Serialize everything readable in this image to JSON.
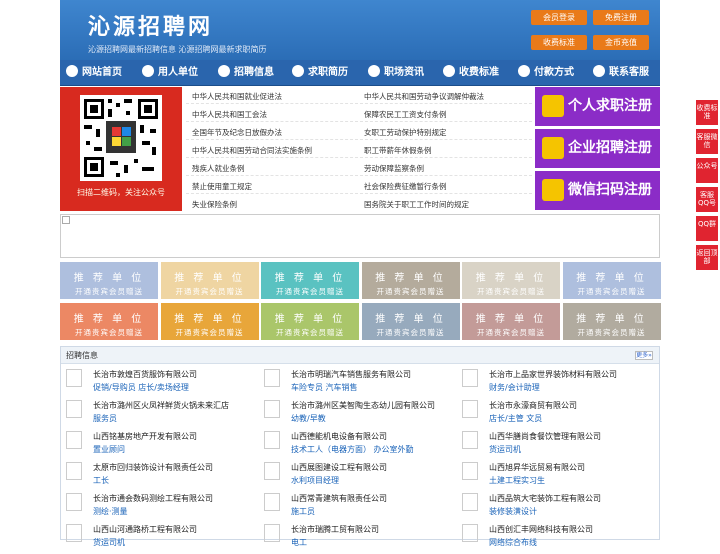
{
  "site": {
    "logo": "沁源招聘网",
    "slogan": "沁源招聘网最新招聘信息 沁源招聘网最新求职简历"
  },
  "header_buttons": [
    {
      "label": "会员登录"
    },
    {
      "label": "免费注册"
    },
    {
      "label": "收费标准"
    },
    {
      "label": "金币充值"
    }
  ],
  "nav": [
    {
      "label": "网站首页",
      "icon": "home-icon"
    },
    {
      "label": "用人单位",
      "icon": "building-icon"
    },
    {
      "label": "招聘信息",
      "icon": "megaphone-icon"
    },
    {
      "label": "求职简历",
      "icon": "resume-icon"
    },
    {
      "label": "职场资讯",
      "icon": "news-icon"
    },
    {
      "label": "收费标准",
      "icon": "coin-icon"
    },
    {
      "label": "付款方式",
      "icon": "payment-icon"
    },
    {
      "label": "联系客服",
      "icon": "phone-icon"
    }
  ],
  "qr": {
    "caption": "扫描二维码，关注公众号"
  },
  "laws": {
    "left": [
      "中华人民共和国就业促进法",
      "中华人民共和国工会法",
      "全国年节及纪念日放假办法",
      "中华人民共和国劳动合同法实施条例",
      "残疾人就业条例",
      "禁止使用童工规定",
      "失业保险条例"
    ],
    "right": [
      "中华人民共和国劳动争议调解仲裁法",
      "保障农民工工资支付条例",
      "女职工劳动保护特别规定",
      "职工带薪年休假条例",
      "劳动保障监察条例",
      "社会保险费征缴暂行条例",
      "国务院关于职工工作时间的规定"
    ]
  },
  "register": [
    {
      "label": "个人求职注册",
      "icon": "person-icon"
    },
    {
      "label": "企业招聘注册",
      "icon": "company-icon"
    },
    {
      "label": "微信扫码注册",
      "icon": "wechat-icon"
    }
  ],
  "recommend": {
    "title": "推 荐 单 位",
    "sub": "开通贵宾会员赠送",
    "colors": [
      "#aebfde",
      "#efd5a2",
      "#5ac2c1",
      "#b4ab9c",
      "#d9d3c6",
      "#aebfde",
      "#ec8864",
      "#e8a63a",
      "#aac66a",
      "#97aabd",
      "#c39b98",
      "#b1ab9f"
    ]
  },
  "jobs": {
    "title": "招聘信息",
    "more": "更多»",
    "items": [
      {
        "company": "长治市敦煌百货服饰有限公司",
        "post": "促销/导购员 店长/卖场经理"
      },
      {
        "company": "长治市明瑞汽车销售服务有限公司",
        "post": "车险专员 汽车销售"
      },
      {
        "company": "长治市上品家世界装饰材料有限公司",
        "post": "财务/会计助理"
      },
      {
        "company": "长治市潞州区火凤祥鲜货火锅未来汇店",
        "post": "服务员"
      },
      {
        "company": "长治市潞州区美智陶生态幼儿园有限公司",
        "post": "幼教/早教"
      },
      {
        "company": "长治市永濠商贸有限公司",
        "post": "店长/主管 文员"
      },
      {
        "company": "山西铭基房地产开发有限公司",
        "post": "置业顾问"
      },
      {
        "company": "山西德能机电设备有限公司",
        "post": "技术工人（电器方面） 办公室外勤"
      },
      {
        "company": "山西华膳尚食餐饮管理有限公司",
        "post": "货运司机"
      },
      {
        "company": "太原市回归装饰设计有限责任公司",
        "post": "工长"
      },
      {
        "company": "山西展图建设工程有限公司",
        "post": "水利项目经理"
      },
      {
        "company": "山西旭昇华远贸易有限公司",
        "post": "土建工程实习生"
      },
      {
        "company": "长治市通会数码测绘工程有限公司",
        "post": "测绘·测量"
      },
      {
        "company": "山西常青建筑有限责任公司",
        "post": "施工员"
      },
      {
        "company": "山西品筑大宅装饰工程有限公司",
        "post": "装修装潢设计"
      },
      {
        "company": "山西山河通路桥工程有限公司",
        "post": "货运司机"
      },
      {
        "company": "长治市瑞腾工贸有限公司",
        "post": "电工"
      },
      {
        "company": "山西创汇丰网络科技有限公司",
        "post": "网络综合布线"
      }
    ]
  },
  "side": [
    {
      "label": "收费标准"
    },
    {
      "label": "客服微信"
    },
    {
      "label": "公众号"
    },
    {
      "label": "客服QQ号"
    },
    {
      "label": "QQ群"
    },
    {
      "label": "返回顶部"
    }
  ]
}
